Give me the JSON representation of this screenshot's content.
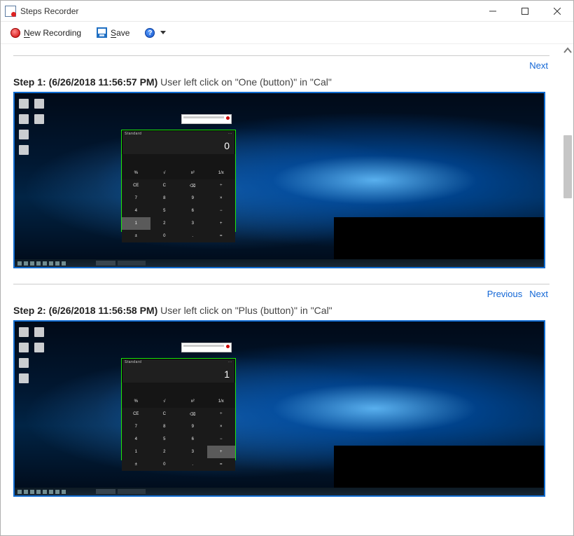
{
  "window": {
    "title": "Steps Recorder"
  },
  "toolbar": {
    "new_recording": "New Recording",
    "save": "Save"
  },
  "nav": {
    "previous": "Previous",
    "next": "Next"
  },
  "steps": [
    {
      "prefix": "Step 1:",
      "timestamp": "(6/26/2018 11:56:57 PM)",
      "description": "User left click on \"One (button)\" in \"Cal\"",
      "calc_mode": "Standard",
      "calc_display": "0",
      "highlight_key": "1"
    },
    {
      "prefix": "Step 2:",
      "timestamp": "(6/26/2018 11:56:58 PM)",
      "description": "User left click on \"Plus (button)\" in \"Cal\"",
      "calc_mode": "Standard",
      "calc_display": "1",
      "highlight_key": "+"
    }
  ],
  "calc": {
    "keys": [
      "",
      "",
      "",
      "",
      "%",
      "√",
      "x²",
      "1/x",
      "CE",
      "C",
      "⌫",
      "÷",
      "7",
      "8",
      "9",
      "×",
      "4",
      "5",
      "6",
      "−",
      "1",
      "2",
      "3",
      "+",
      "±",
      "0",
      ".",
      "="
    ]
  }
}
